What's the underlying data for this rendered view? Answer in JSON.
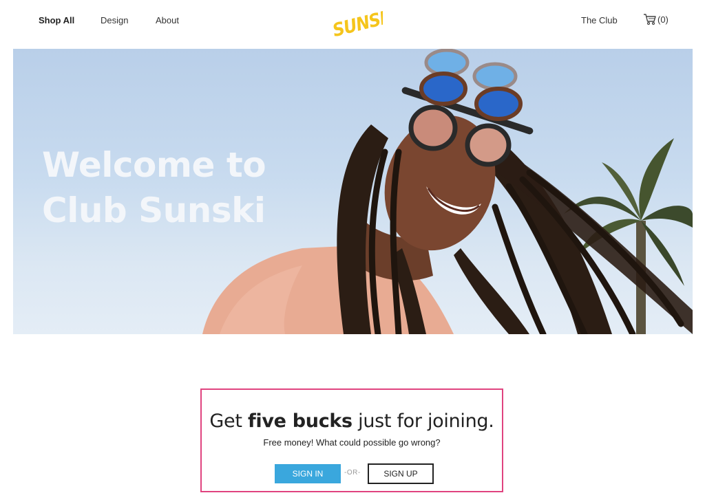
{
  "nav": {
    "shop_all": "Shop All",
    "design": "Design",
    "about": "About",
    "the_club": "The Club",
    "cart_count": "(0)"
  },
  "logo": {
    "text": "SUNSKI",
    "color": "#f5c51c"
  },
  "hero": {
    "line1": "Welcome to",
    "line2": "Club Sunski"
  },
  "promo": {
    "headline_pre": "Get ",
    "headline_bold": "five bucks",
    "headline_post": " just for joining.",
    "subtext": "Free money! What could possible go wrong?",
    "sign_in": "SIGN IN",
    "or": "-OR-",
    "sign_up": "SIGN UP",
    "highlight_color": "#e0437f",
    "button_color": "#3aa7dd"
  }
}
